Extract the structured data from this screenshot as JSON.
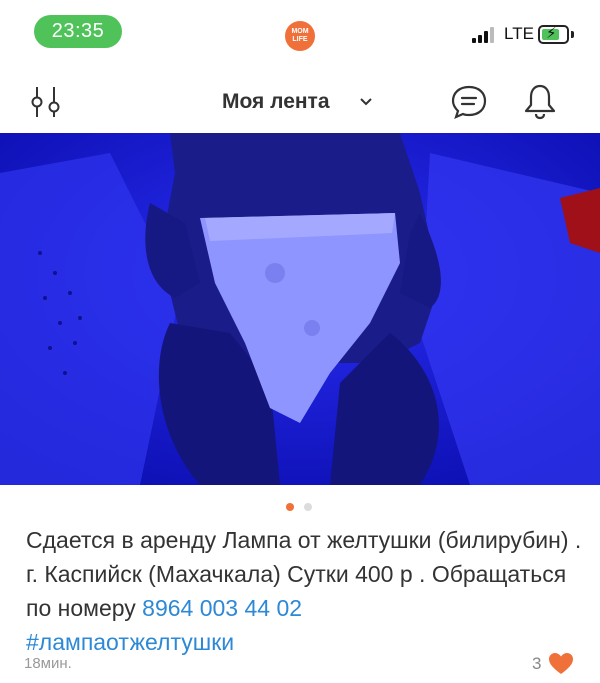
{
  "status_bar": {
    "time": "23:35",
    "app_logo_text": "MOM LIFE",
    "network": "LTE",
    "accent_color": "#4fc35a"
  },
  "header": {
    "title": "Моя лента",
    "icons": [
      "filter-icon",
      "chevron-down-icon",
      "chat-icon",
      "bell-icon"
    ]
  },
  "post": {
    "image_description_icon": "photo",
    "pager": {
      "total": 2,
      "active": 0,
      "active_color": "#f0703a"
    },
    "text_main": "Сдается в аренду Лампа от желтушки (билирубин) . г. Каспийск (Махачкала) Сутки 400 р . Обращаться по номеру ",
    "phone": "8964 003 44 02",
    "hashtag": "#лампаотжелтушки",
    "time_ago": "18мин.",
    "likes": "3",
    "link_color": "#2d88d6",
    "heart_color": "#f0703a"
  }
}
